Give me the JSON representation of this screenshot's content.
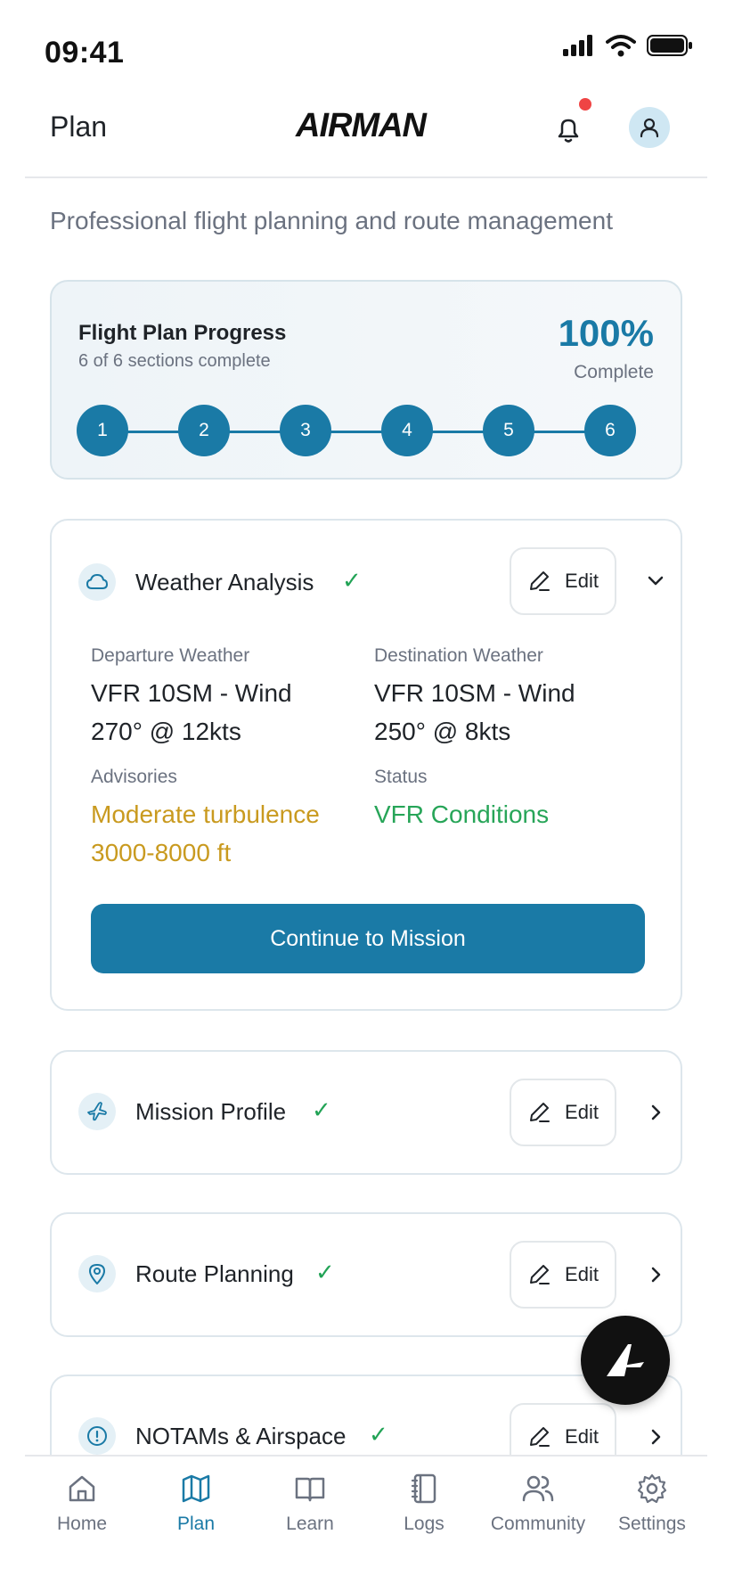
{
  "status_bar": {
    "time": "09:41"
  },
  "header": {
    "title": "Plan",
    "logo_text": "AIRMAN",
    "has_notification": true
  },
  "subtitle": "Professional flight planning and route management",
  "progress": {
    "title": "Flight Plan Progress",
    "sections_text": "6 of 6 sections complete",
    "percent_text": "100%",
    "percent_label": "Complete",
    "completion": 1.0,
    "steps": [
      "1",
      "2",
      "3",
      "4",
      "5",
      "6"
    ]
  },
  "weather": {
    "title": "Weather Analysis",
    "edit_label": "Edit",
    "departure_label": "Departure Weather",
    "departure_value": "VFR 10SM - Wind 270° @ 12kts",
    "destination_label": "Destination Weather",
    "destination_value": "VFR 10SM - Wind 250° @ 8kts",
    "advisories_label": "Advisories",
    "advisories_value": "Moderate turbulence 3000-8000 ft",
    "status_label": "Status",
    "status_value": "VFR Conditions",
    "continue_label": "Continue to Mission"
  },
  "sections": [
    {
      "title": "Mission Profile",
      "edit_label": "Edit",
      "icon": "plane-icon"
    },
    {
      "title": "Route Planning",
      "edit_label": "Edit",
      "icon": "map-pin-icon"
    },
    {
      "title": "NOTAMs & Airspace",
      "edit_label": "Edit",
      "icon": "alert-circle-icon"
    }
  ],
  "tabs": [
    {
      "label": "Home",
      "icon": "home-icon"
    },
    {
      "label": "Plan",
      "icon": "map-icon",
      "active": true
    },
    {
      "label": "Learn",
      "icon": "book-open-icon"
    },
    {
      "label": "Logs",
      "icon": "notebook-icon"
    },
    {
      "label": "Community",
      "icon": "users-icon"
    },
    {
      "label": "Settings",
      "icon": "gear-icon"
    }
  ],
  "colors": {
    "accent": "#1a7aa6",
    "success": "#22a356",
    "warning": "#c99a1f",
    "notification": "#ef4444"
  }
}
